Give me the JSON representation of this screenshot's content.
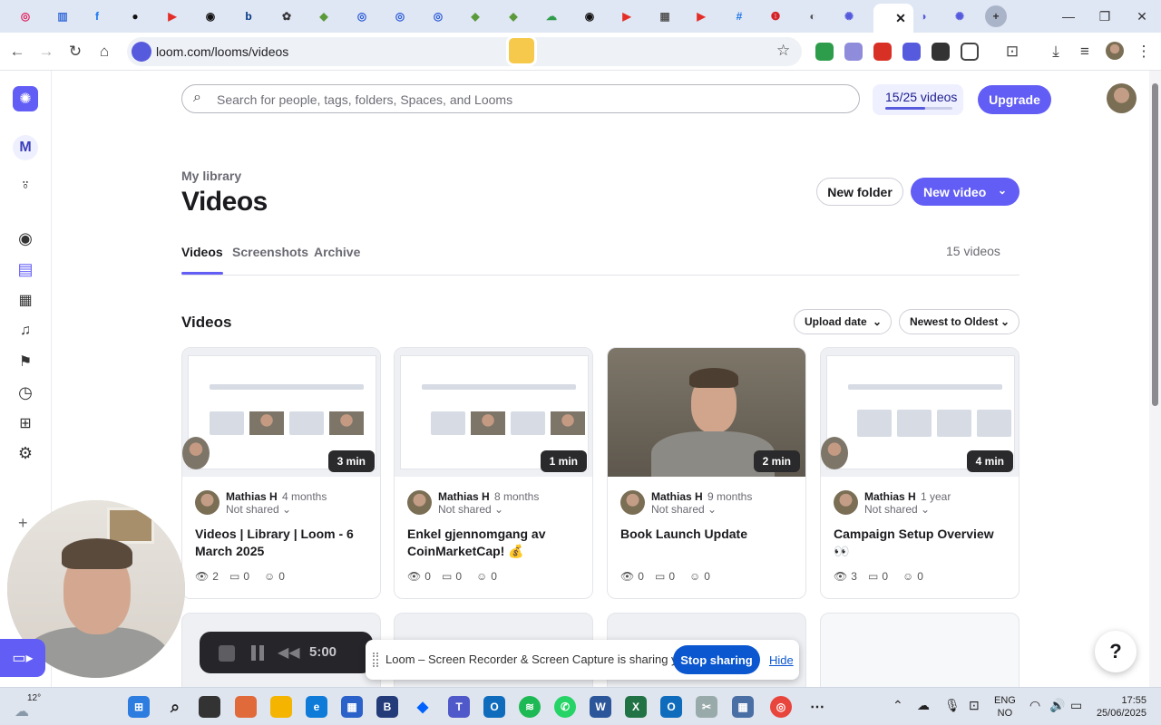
{
  "browser": {
    "url": "loom.com/looms/videos",
    "tab_icons": [
      "target-icon",
      "chart-icon",
      "facebook-icon",
      "upwork-icon",
      "youtube-icon",
      "threads-icon",
      "booking-icon",
      "openai-icon",
      "shopify-icon",
      "circle-icon",
      "circle-icon",
      "circle-icon",
      "shopify-icon",
      "shopify-icon",
      "cloud-icon",
      "threads-icon",
      "youtube-icon",
      "grid-icon",
      "youtube-icon",
      "hash-icon",
      "app-icon",
      "globe-icon",
      "loom-icon",
      "loom-tab-active",
      "loom-icon",
      "loom-icon"
    ]
  },
  "search": {
    "placeholder": "Search for people, tags, folders, Spaces, and Looms"
  },
  "quota": {
    "label": "15/25 videos",
    "used_fraction": 0.6
  },
  "upgrade_label": "Upgrade",
  "workspace_initial": "M",
  "page": {
    "breadcrumb": "My library",
    "title": "Videos",
    "new_folder": "New folder",
    "new_video": "New video",
    "tabs": [
      "Videos",
      "Screenshots",
      "Archive"
    ],
    "count": "15 videos",
    "section": "Videos",
    "sort_upload": "Upload date",
    "sort_order": "Newest to Oldest"
  },
  "videos": [
    {
      "duration": "3 min",
      "author": "Mathias H",
      "ago": "4 months",
      "sharing": "Not shared",
      "title": "Videos | Library | Loom - 6 March 2025",
      "views": "2",
      "comments": "0",
      "reactions": "0"
    },
    {
      "duration": "1 min",
      "author": "Mathias H",
      "ago": "8 months",
      "sharing": "Not shared",
      "title": "Enkel gjennomgang av CoinMarketCap! 💰",
      "views": "0",
      "comments": "0",
      "reactions": "0"
    },
    {
      "duration": "2 min",
      "author": "Mathias H",
      "ago": "9 months",
      "sharing": "Not shared",
      "title": "Book Launch Update",
      "views": "0",
      "comments": "0",
      "reactions": "0"
    },
    {
      "duration": "4 min",
      "author": "Mathias H",
      "ago": "1 year",
      "sharing": "Not shared",
      "title": "Campaign Setup Overview 👀",
      "views": "3",
      "comments": "0",
      "reactions": "0"
    }
  ],
  "recorder": {
    "time": "5:00"
  },
  "share_bar": {
    "message": "Loom – Screen Recorder & Screen Capture is sharing your screen.",
    "stop": "Stop sharing",
    "hide": "Hide"
  },
  "help": "?",
  "taskbar": {
    "temp": "12°",
    "lang1": "ENG",
    "lang2": "NO",
    "time": "17:55",
    "date": "25/06/2025"
  }
}
